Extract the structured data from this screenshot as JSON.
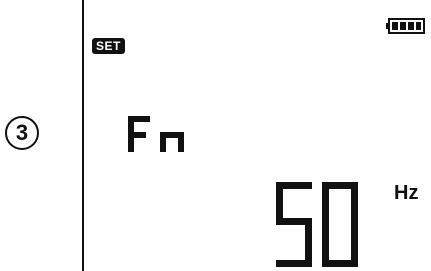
{
  "step": {
    "number": "3"
  },
  "display": {
    "mode_badge": "SET",
    "parameter": "Fn",
    "value": "50",
    "unit": "Hz",
    "battery_icon": "battery-full-icon",
    "battery_level": 1.0
  },
  "colors": {
    "segment": "#111111",
    "background": "#ffffff"
  }
}
